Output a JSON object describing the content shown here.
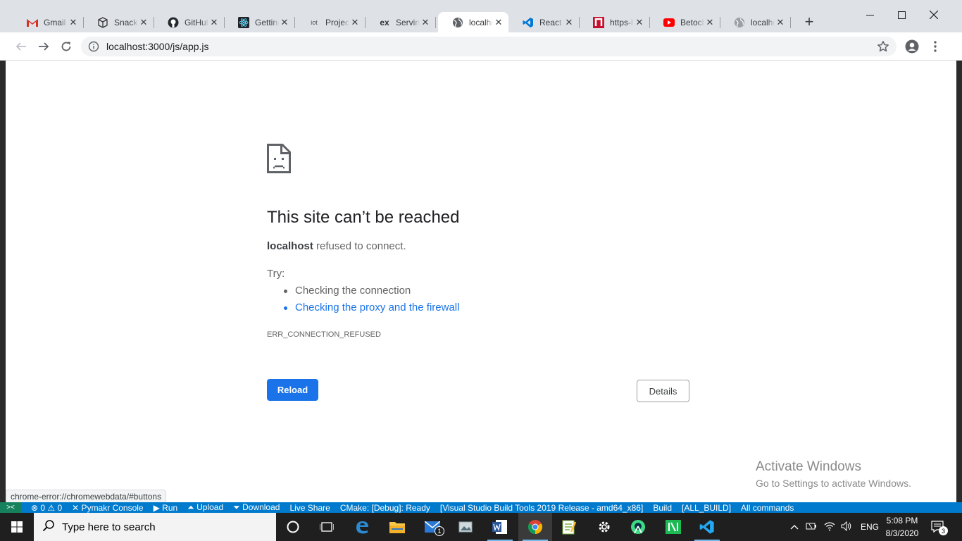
{
  "browser": {
    "tabs": [
      {
        "title": "Gmail - ",
        "icon": "gmail-icon"
      },
      {
        "title": "Snack - ",
        "icon": "snack-icon"
      },
      {
        "title": "GitHub",
        "icon": "github-icon"
      },
      {
        "title": "Getting",
        "icon": "react-icon"
      },
      {
        "title": "Project",
        "icon": "iot-icon"
      },
      {
        "title": "Serving",
        "icon": "express-icon"
      },
      {
        "title": "localhost",
        "icon": "globe-icon",
        "active": true
      },
      {
        "title": "React J",
        "icon": "vscode-icon"
      },
      {
        "title": "https-l",
        "icon": "n-icon"
      },
      {
        "title": "Betoch",
        "icon": "youtube-icon"
      },
      {
        "title": "localhost",
        "icon": "globe-icon"
      }
    ],
    "url": "localhost:3000/js/app.js"
  },
  "error_page": {
    "heading": "This site can’t be reached",
    "host": "localhost",
    "message": " refused to connect.",
    "try_label": "Try:",
    "suggestions": [
      "Checking the connection",
      "Checking the proxy and the firewall"
    ],
    "error_code": "ERR_CONNECTION_REFUSED",
    "reload_label": "Reload",
    "details_label": "Details"
  },
  "watermark": {
    "title": "Activate Windows",
    "subtitle": "Go to Settings to activate Windows."
  },
  "status_url": "chrome-error://chromewebdata/#buttons",
  "vscode_status": {
    "problems": "⊗ 0 ⚠ 0",
    "pymakr": "✕ Pymakr Console",
    "run": "▶ Run",
    "upload": "⏶ Upload",
    "download": "⏷ Download",
    "liveshare": "Live Share",
    "cmake": "CMake: [Debug]: Ready",
    "kit": "[Visual Studio Build Tools 2019 Release - amd64_x86]",
    "build": "Build",
    "target": "[ALL_BUILD]",
    "commands": "All commands"
  },
  "taskbar": {
    "search_placeholder": "Type here to search",
    "language": "ENG",
    "time": "5:08 PM",
    "date": "8/3/2020",
    "mail_badge": "1",
    "notification_count": "3"
  },
  "colors": {
    "accent": "#1a73e8",
    "vscode_blue": "#007acc",
    "taskbar": "#1f1f1f"
  }
}
